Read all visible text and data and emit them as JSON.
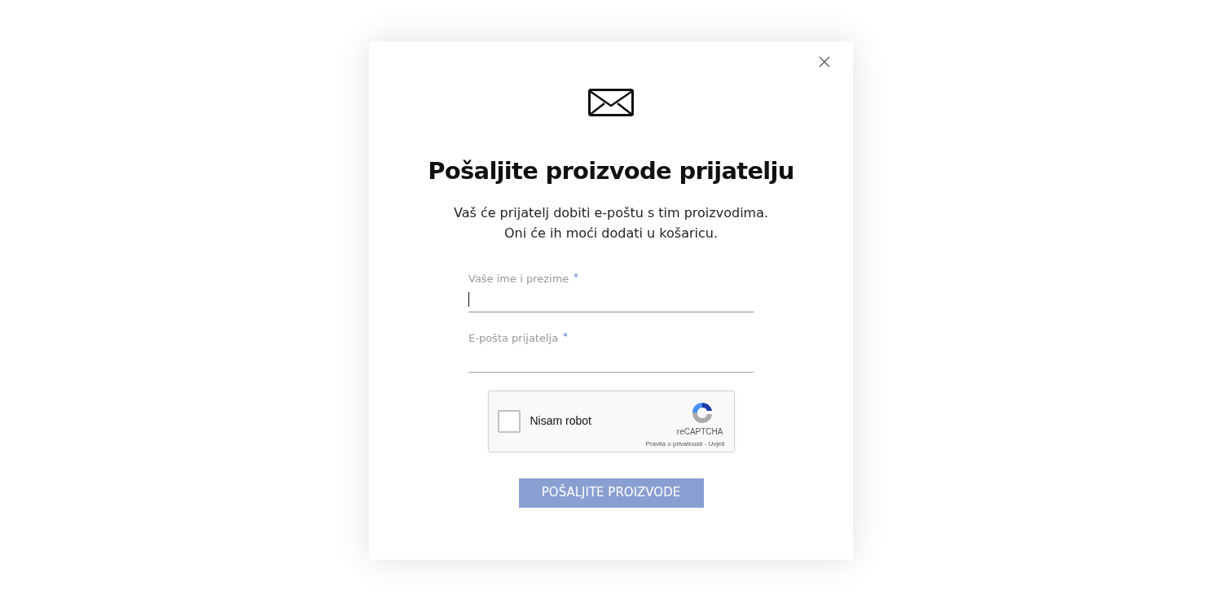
{
  "dialog": {
    "title": "Pošaljite proizvode prijatelju",
    "description": [
      "Vaš će prijatelj dobiti e-poštu s tim proizvodima.",
      "Oni će ih moći dodati u košaricu."
    ]
  },
  "fields": [
    {
      "label": "Vaše ime i prezime",
      "required_mark": "*",
      "focused": true
    },
    {
      "label": "E-pošta prijatelja",
      "required_mark": "*",
      "focused": false
    }
  ],
  "captcha": {
    "label": "Nisam robot",
    "checked": false,
    "brand": "reCAPTCHA",
    "links": "Pravila o privatnosti - Uvjeti"
  },
  "submit": {
    "label": "POŠALJITE PROIZVODE",
    "disabled": true
  }
}
